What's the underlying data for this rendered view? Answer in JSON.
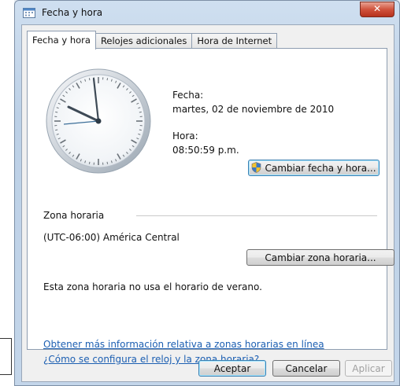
{
  "window": {
    "title": "Fecha y hora"
  },
  "tabs": [
    {
      "label": "Fecha y hora"
    },
    {
      "label": "Relojes adicionales"
    },
    {
      "label": "Hora de Internet"
    }
  ],
  "date": {
    "label": "Fecha:",
    "value": "martes, 02 de noviembre de 2010"
  },
  "time": {
    "label": "Hora:",
    "value": "08:50:59 p.m."
  },
  "buttons": {
    "change_datetime": "Cambiar fecha y hora...",
    "change_timezone": "Cambiar zona horaria...",
    "ok": "Aceptar",
    "cancel": "Cancelar",
    "apply": "Aplicar"
  },
  "timezone": {
    "section_label": "Zona horaria",
    "value": "(UTC-06:00) América Central",
    "dst_note": "Esta zona horaria no usa el horario de verano."
  },
  "links": {
    "more_info": "Obtener más información relativa a zonas horarias en línea",
    "how_to": "¿Cómo se configura el reloj y la zona horaria?"
  },
  "colors": {
    "link": "#1c5fb2",
    "close_button": "#c94a35"
  }
}
